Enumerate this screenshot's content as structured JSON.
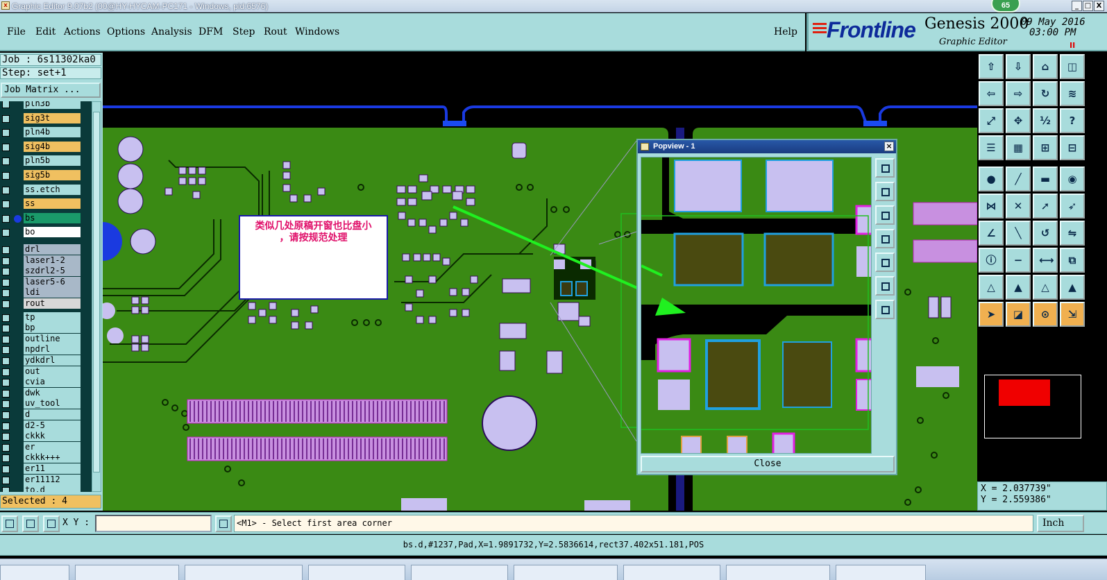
{
  "window": {
    "title": "Graphic Editor 9.07b2 (00@HY-HYCAM-PC171 - Windows, pid:6576)",
    "badge": "65",
    "controls": [
      "_",
      "□",
      "X"
    ]
  },
  "menu": {
    "items": [
      "File",
      "Edit",
      "Actions",
      "Options",
      "Analysis",
      "DFM",
      "Step",
      "Rout",
      "Windows"
    ],
    "help": "Help"
  },
  "brand": {
    "logo": "Frontline",
    "product": "Genesis 2000",
    "subtitle": "Graphic Editor",
    "date": "09 May 2016",
    "time": "03:00 PM",
    "pause": "II"
  },
  "job": {
    "job_line": "Job : 6s11302ka0",
    "step_line": "Step: set+1",
    "matrix_button": "Job Matrix ..."
  },
  "layers": [
    {
      "name": "pln3b",
      "color": "#a8dcdc"
    },
    {
      "name": "sig3t",
      "color": "#f0c060"
    },
    {
      "name": "pln4b",
      "color": "#a8dcdc"
    },
    {
      "name": "sig4b",
      "color": "#f0c060"
    },
    {
      "name": "pln5b",
      "color": "#a8dcdc"
    },
    {
      "name": "sig5b",
      "color": "#f0c060"
    },
    {
      "name": "ss.etch",
      "color": "#a8dcdc"
    },
    {
      "name": "ss",
      "color": "#f0c060"
    },
    {
      "name": "bs",
      "color": "#1a9a6a",
      "active": true
    },
    {
      "name": "bo",
      "color": "#ffffff"
    },
    {
      "name": "drl",
      "color": "#a8b8c8"
    },
    {
      "name": "laser1-2",
      "color": "#a8b8c8"
    },
    {
      "name": "szdrl2-5",
      "color": "#a8b8c8"
    },
    {
      "name": "laser5-6",
      "color": "#a8b8c8"
    },
    {
      "name": "ldi",
      "color": "#a8b8c8"
    },
    {
      "name": "rout",
      "color": "#d8d8d8"
    },
    {
      "name": "tp",
      "color": "#a8dcdc"
    },
    {
      "name": "bp",
      "color": "#a8dcdc"
    },
    {
      "name": "outline",
      "color": "#a8dcdc"
    },
    {
      "name": "npdrl",
      "color": "#a8dcdc"
    },
    {
      "name": "ydkdrl",
      "color": "#a8dcdc"
    },
    {
      "name": "out",
      "color": "#a8dcdc"
    },
    {
      "name": "cvia",
      "color": "#a8dcdc"
    },
    {
      "name": "dwk",
      "color": "#a8dcdc"
    },
    {
      "name": "uv_tool",
      "color": "#a8dcdc"
    },
    {
      "name": "d",
      "color": "#a8dcdc"
    },
    {
      "name": "d2-5",
      "color": "#a8dcdc"
    },
    {
      "name": "ckkk",
      "color": "#a8dcdc"
    },
    {
      "name": "er",
      "color": "#a8dcdc"
    },
    {
      "name": "ckkk+++",
      "color": "#a8dcdc"
    },
    {
      "name": "er11",
      "color": "#a8dcdc"
    },
    {
      "name": "er11112",
      "color": "#a8dcdc"
    },
    {
      "name": "to.d",
      "color": "#a8dcdc"
    }
  ],
  "selected": "Selected : 4",
  "annotation": {
    "line1": "类似几处原稿开窗也比盘小",
    "line2": "，请按规范处理"
  },
  "popview": {
    "title": "Popview - 1",
    "close_label": "Close"
  },
  "coords": {
    "x": "X = 2.037739\"",
    "y": "Y = 2.559386\""
  },
  "command": {
    "xy_label": "X Y :",
    "xy_value": "",
    "prompt": "<M1> - Select first area corner",
    "units": "Inch"
  },
  "status": "bs.d,#1237,Pad,X=1.9891732,Y=2.5836614,rect37.402x51.181,POS",
  "colors": {
    "panel": "#a8dcdc",
    "board": "#3a8a14",
    "pad": "#c8c0f0",
    "pad_edge": "#c020c0",
    "highlight_arrow": "#20f020",
    "trace": "#0a3a00"
  }
}
